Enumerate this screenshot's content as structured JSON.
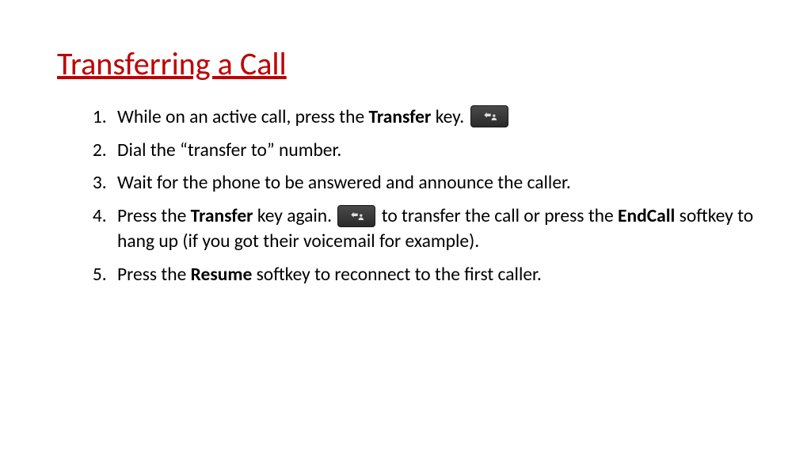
{
  "title": "Transferring a Call",
  "steps": {
    "s1a": "While on an active call, press the ",
    "s1b": "Transfer",
    "s1c": " key. ",
    "s2": "Dial the “transfer to” number.",
    "s3": "Wait for the phone to be answered and announce the caller.",
    "s4a": "Press the ",
    "s4b": "Transfer",
    "s4c": " key again. ",
    "s4d": " to transfer the call or press the ",
    "s4e": "EndCall",
    "s4f": " softkey to hang up (if you got their voicemail for example).",
    "s5a": "Press the ",
    "s5b": "Resume",
    "s5c": " softkey to reconnect to the first caller."
  }
}
